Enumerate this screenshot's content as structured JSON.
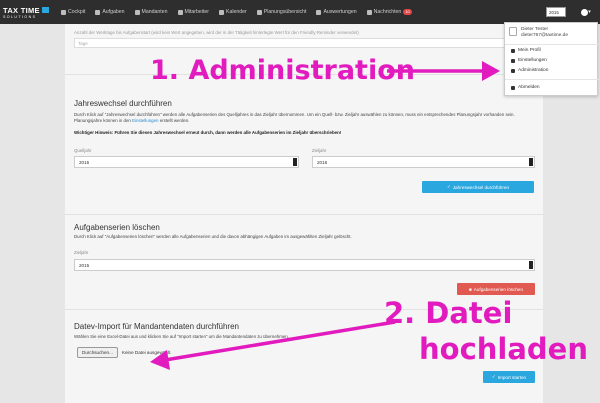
{
  "brand": {
    "line1": "TAX TIME",
    "line2": "SOLUTIONS"
  },
  "nav": [
    {
      "label": "Cockpit",
      "icon": "dashboard-icon"
    },
    {
      "label": "Aufgaben",
      "icon": "flag-icon"
    },
    {
      "label": "Mandanten",
      "icon": "folder-icon"
    },
    {
      "label": "Mitarbeiter",
      "icon": "users-icon"
    },
    {
      "label": "Kalender",
      "icon": "calendar-icon"
    },
    {
      "label": "Planungsübersicht",
      "icon": "grid-icon"
    },
    {
      "label": "Auswertungen",
      "icon": "chart-icon"
    },
    {
      "label": "Nachrichten",
      "icon": "message-icon",
      "badge": "10"
    }
  ],
  "year_select": "2015",
  "reminder": {
    "text": "Anzahl der Werktage bis Aufgabenstart (wird kein Wert angegeben, wird der in der Tätigkeit hinterlegte Wert für den Friendly Reminder verwendet)",
    "placeholder": "Tage"
  },
  "jahreswechsel": {
    "title": "Jahreswechsel durchführen",
    "desc1": "Durch Klick auf \"Jahreswechsel durchführen\" werden alle Aufgabenserien des Quelljahres in das Zieljahr übernommen. Um ein Quell- bzw. Zieljahr auswählen zu können, muss ein entsprechendes Planungsjahr vorhanden sein. Planungsjahre können in den",
    "desc_link": "Einstellungen",
    "desc2": "erstellt werden.",
    "warning": "Wichtiger Hinweis: Führen Sie diesen Jahreswechsel erneut durch, dann werden alle Aufgabenserien im Zieljahr überschrieben!",
    "source_label": "Quelljahr",
    "source_value": "2015",
    "target_label": "Zieljahr",
    "target_value": "2016",
    "button": "Jahreswechsel durchführen"
  },
  "serien": {
    "title": "Aufgabenserien löschen",
    "desc": "Durch Klick auf \"Aufgabenserien löschen\" werden alle Aufgabenserien und die davon abhängigen Aufgaben im ausgewählten Zieljahr gelöscht.",
    "label": "Zieljahr",
    "value": "2015",
    "button": "Aufgabenserien löschen"
  },
  "import": {
    "title": "Datev-Import für Mandantendaten durchführen",
    "desc": "Wählen Sie eine Excel-Datei aus und klicken Sie auf \"Import starten\" um die Mandantendaten zu übernehmen.",
    "file_button": "Durchsuchen...",
    "file_status": "Keine Datei ausgewählt.",
    "button": "Import starten"
  },
  "user_menu": {
    "name": "Dieter Tester",
    "email": "dieter767@taxtime.de",
    "items": [
      {
        "label": "Mein Profil",
        "icon": "user-icon"
      },
      {
        "label": "Einstellungen",
        "icon": "gear-icon"
      },
      {
        "label": "Administration",
        "icon": "list-icon"
      }
    ],
    "logout": "Abmelden"
  },
  "annotations": {
    "step1": "1. Administration",
    "step2a": "2. Datei",
    "step2b": "hochladen"
  },
  "colors": {
    "accent": "#2aa7df",
    "danger": "#e05a52",
    "annotation": "#e21bbf",
    "navbar": "#2e2e2e"
  }
}
